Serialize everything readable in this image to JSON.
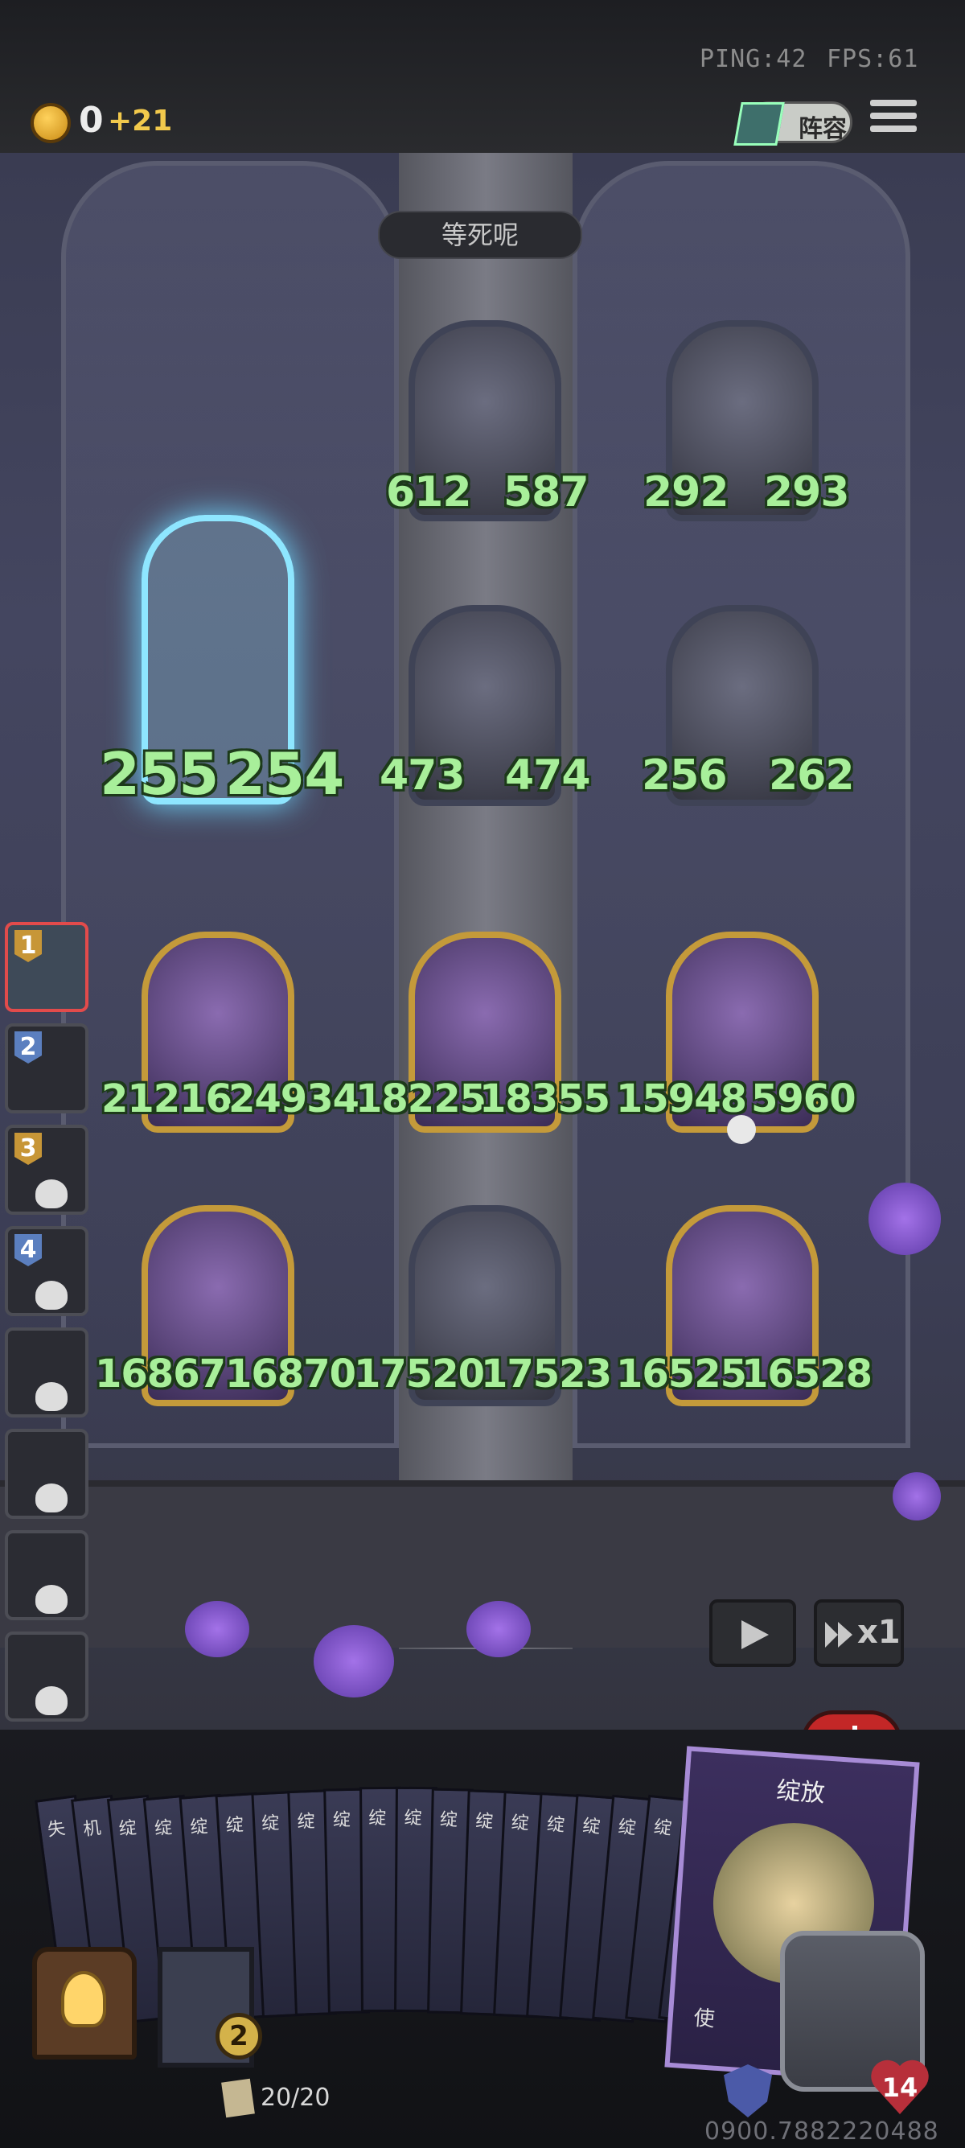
{
  "network": {
    "ping": "PING:42",
    "fps": "FPS:61"
  },
  "currency": {
    "amount": "0",
    "income": "+21"
  },
  "toolbar": {
    "lineup_label": "阵容"
  },
  "opponent": {
    "name": "等死呢"
  },
  "board": {
    "cards": [
      {
        "id": "pirate",
        "attack": "612",
        "health": "587"
      },
      {
        "id": "knight",
        "attack": "292",
        "health": "293"
      },
      {
        "id": "scout",
        "attack": "473",
        "health": "474"
      },
      {
        "id": "reaper",
        "attack": "256",
        "health": "262"
      },
      {
        "id": "ghost-summon",
        "attack": "255",
        "health": "254"
      },
      {
        "id": "sunflower",
        "attack": "21216",
        "health": "24934"
      },
      {
        "id": "dryad-1",
        "attack": "18225",
        "health": "18355"
      },
      {
        "id": "witch",
        "attack": "15948",
        "health": "5960"
      },
      {
        "id": "golden-book",
        "attack": "16867",
        "health": "16870"
      },
      {
        "id": "white-hair",
        "attack": "17520",
        "health": "17523"
      },
      {
        "id": "dryad-2",
        "attack": "16525",
        "health": "16528"
      }
    ]
  },
  "lane": {
    "slots": [
      {
        "num": "1",
        "status": "active"
      },
      {
        "num": "2",
        "status": "alive"
      },
      {
        "num": "3",
        "status": "dead"
      },
      {
        "num": "4",
        "status": "dead"
      },
      {
        "num": "",
        "status": "dead"
      },
      {
        "num": "",
        "status": "dead"
      },
      {
        "num": "",
        "status": "dead"
      },
      {
        "num": "",
        "status": "dead"
      }
    ]
  },
  "playback": {
    "speed": "x1"
  },
  "hand": {
    "cards": [
      "失",
      "机",
      "绽",
      "绽",
      "绽",
      "绽",
      "绽",
      "绽",
      "绽",
      "绽",
      "绽",
      "绽",
      "绽",
      "绽",
      "绽",
      "绽",
      "绽",
      "绽",
      "绽"
    ],
    "featured": {
      "title": "绽放",
      "use_text": "使"
    }
  },
  "deck": {
    "count": "20/20",
    "energy": "2"
  },
  "hero": {
    "hp": "14"
  },
  "footer": {
    "id_text": "0900.7882220488"
  },
  "colors": {
    "stat_green": "#a8ef9a",
    "active_slot": "#e24b4b",
    "coin": "#f2c94c"
  }
}
